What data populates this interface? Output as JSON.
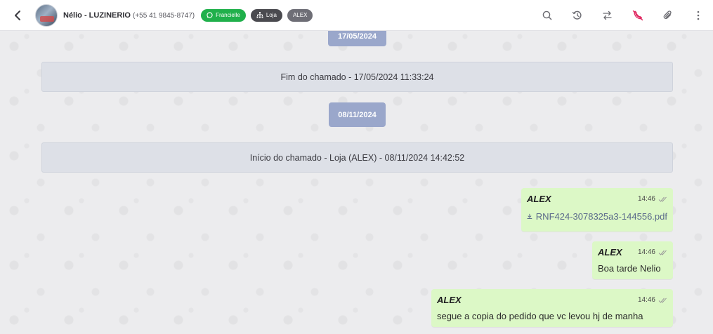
{
  "header": {
    "contact_name": "Nélio - LUZINERIO",
    "contact_phone": "(+55 41 9845-8747)",
    "tags": {
      "agent": "Francielle",
      "store": "Loja",
      "user": "ALEX"
    },
    "icons": [
      "back-icon",
      "avatar",
      "search-icon",
      "history-icon",
      "transfer-icon",
      "end-call-icon",
      "attachment-icon",
      "more-icon"
    ]
  },
  "chat": {
    "prev_date": "17/05/2024",
    "end_ticket": "Fim do chamado - 17/05/2024 11:33:24",
    "date_pill": "08/11/2024",
    "start_ticket": "Início do chamado - Loja (ALEX) - 08/11/2024 14:42:52",
    "messages": [
      {
        "sender": "ALEX",
        "time": "14:46",
        "file_name": "RNF424-3078325a3-144556.pdf"
      },
      {
        "sender": "ALEX",
        "time": "14:46",
        "text": "Boa tarde Nelio"
      },
      {
        "sender": "ALEX",
        "time": "14:46",
        "text": "segue a copia do pedido que vc levou hj de manha"
      }
    ]
  },
  "colors": {
    "bubble": "#dcf8c6",
    "date_pill": "#9aa7cb",
    "system_box": "#dde0e7",
    "tag_green": "#20b04b",
    "end_call_icon": "#e0245e"
  }
}
